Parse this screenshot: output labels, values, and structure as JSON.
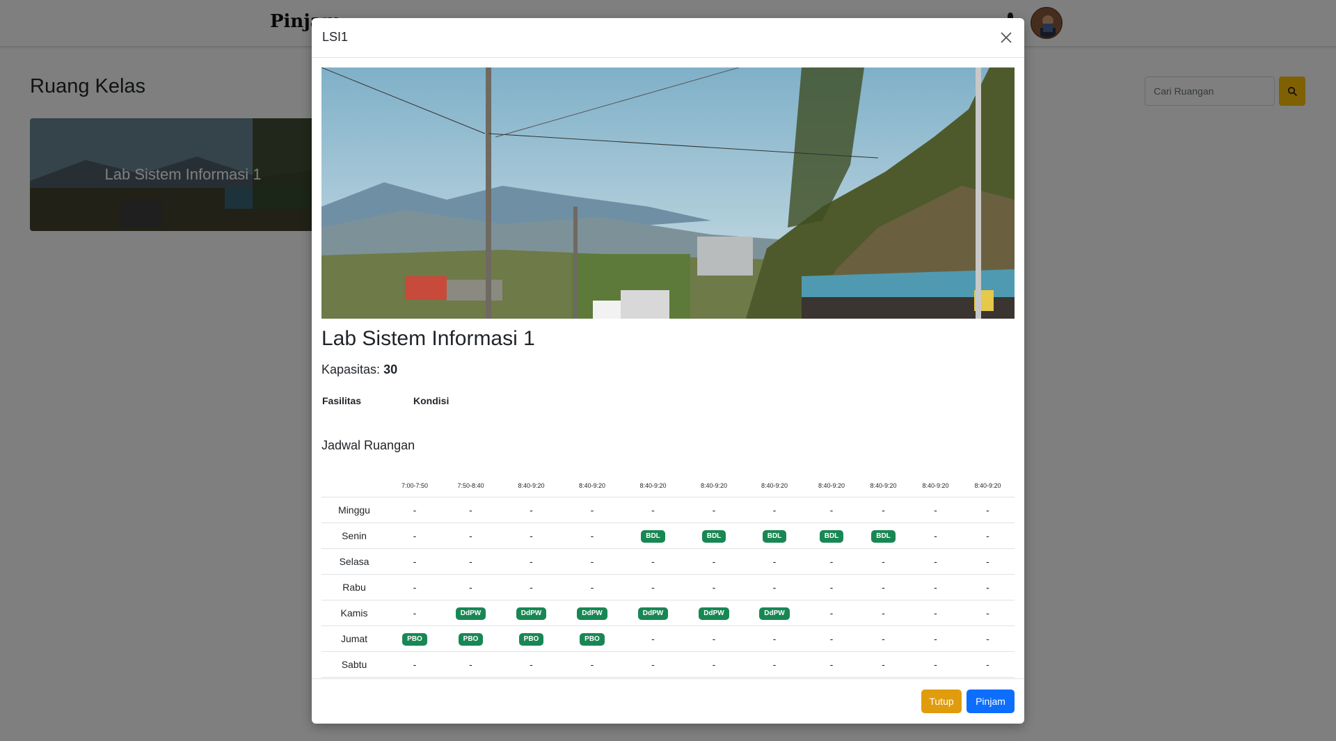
{
  "app": {
    "brand": "Pinjam"
  },
  "page": {
    "title": "Ruang Kelas",
    "search": {
      "placeholder": "Cari Ruangan"
    }
  },
  "cards": [
    {
      "title": "Lab Sistem Informasi 1"
    }
  ],
  "modal": {
    "header_title": "LSI1",
    "room_name": "Lab Sistem Informasi 1",
    "capacity_label": "Kapasitas:",
    "capacity_value": "30",
    "facilities_label": "Fasilitas",
    "condition_label": "Kondisi",
    "schedule_title": "Jadwal Ruangan",
    "schedule": {
      "times": [
        "7:00-7:50",
        "7:50-8:40",
        "8:40-9:20",
        "8:40-9:20",
        "8:40-9:20",
        "8:40-9:20",
        "8:40-9:20",
        "8:40-9:20",
        "8:40-9:20",
        "8:40-9:20",
        "8:40-9:20"
      ],
      "rows": [
        {
          "day": "Minggu",
          "cells": [
            "-",
            "-",
            "-",
            "-",
            "-",
            "-",
            "-",
            "-",
            "-",
            "-",
            "-"
          ]
        },
        {
          "day": "Senin",
          "cells": [
            "-",
            "-",
            "-",
            "-",
            "BDL",
            "BDL",
            "BDL",
            "BDL",
            "BDL",
            "-",
            "-"
          ]
        },
        {
          "day": "Selasa",
          "cells": [
            "-",
            "-",
            "-",
            "-",
            "-",
            "-",
            "-",
            "-",
            "-",
            "-",
            "-"
          ]
        },
        {
          "day": "Rabu",
          "cells": [
            "-",
            "-",
            "-",
            "-",
            "-",
            "-",
            "-",
            "-",
            "-",
            "-",
            "-"
          ]
        },
        {
          "day": "Kamis",
          "cells": [
            "-",
            "DdPW",
            "DdPW",
            "DdPW",
            "DdPW",
            "DdPW",
            "DdPW",
            "-",
            "-",
            "-",
            "-"
          ]
        },
        {
          "day": "Jumat",
          "cells": [
            "PBO",
            "PBO",
            "PBO",
            "PBO",
            "-",
            "-",
            "-",
            "-",
            "-",
            "-",
            "-"
          ]
        },
        {
          "day": "Sabtu",
          "cells": [
            "-",
            "-",
            "-",
            "-",
            "-",
            "-",
            "-",
            "-",
            "-",
            "-",
            "-"
          ]
        }
      ]
    },
    "buttons": {
      "close_label": "Tutup",
      "borrow_label": "Pinjam"
    }
  },
  "colors": {
    "badge": "#198754",
    "primary": "#0d6efd",
    "warning": "#e09c0c"
  },
  "icons": [
    "bell-icon",
    "avatar",
    "search-icon",
    "close-icon"
  ]
}
